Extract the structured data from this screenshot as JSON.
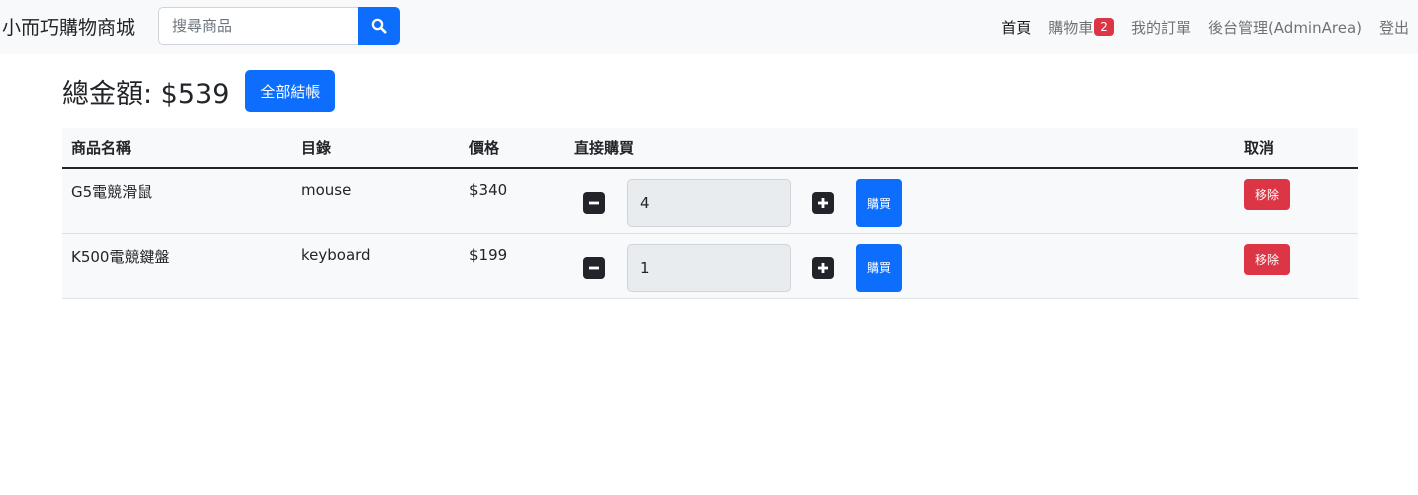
{
  "navbar": {
    "brand": "小而巧購物商城",
    "search_placeholder": "搜尋商品",
    "links": {
      "home": "首頁",
      "cart": "購物車",
      "cart_count": "2",
      "orders": "我的訂單",
      "admin": "後台管理(AdminArea)",
      "logout": "登出"
    }
  },
  "summary": {
    "total_label": "總金額: $539",
    "checkout_label": "全部結帳"
  },
  "table": {
    "headers": {
      "name": "商品名稱",
      "category": "目錄",
      "price": "價格",
      "buy": "直接購買",
      "cancel": "取消"
    },
    "rows": [
      {
        "name": "G5電競滑鼠",
        "category": "mouse",
        "price": "$340",
        "qty": "4",
        "buy_label": "購買",
        "remove_label": "移除"
      },
      {
        "name": "K500電競鍵盤",
        "category": "keyboard",
        "price": "$199",
        "qty": "1",
        "buy_label": "購買",
        "remove_label": "移除"
      }
    ]
  },
  "icons": {
    "search": "search-icon",
    "minus": "minus-square-icon",
    "plus": "plus-square-icon"
  },
  "colors": {
    "primary": "#0d6efd",
    "danger": "#dc3545",
    "dark": "#212529",
    "navbar_bg": "#f8f9fa"
  }
}
